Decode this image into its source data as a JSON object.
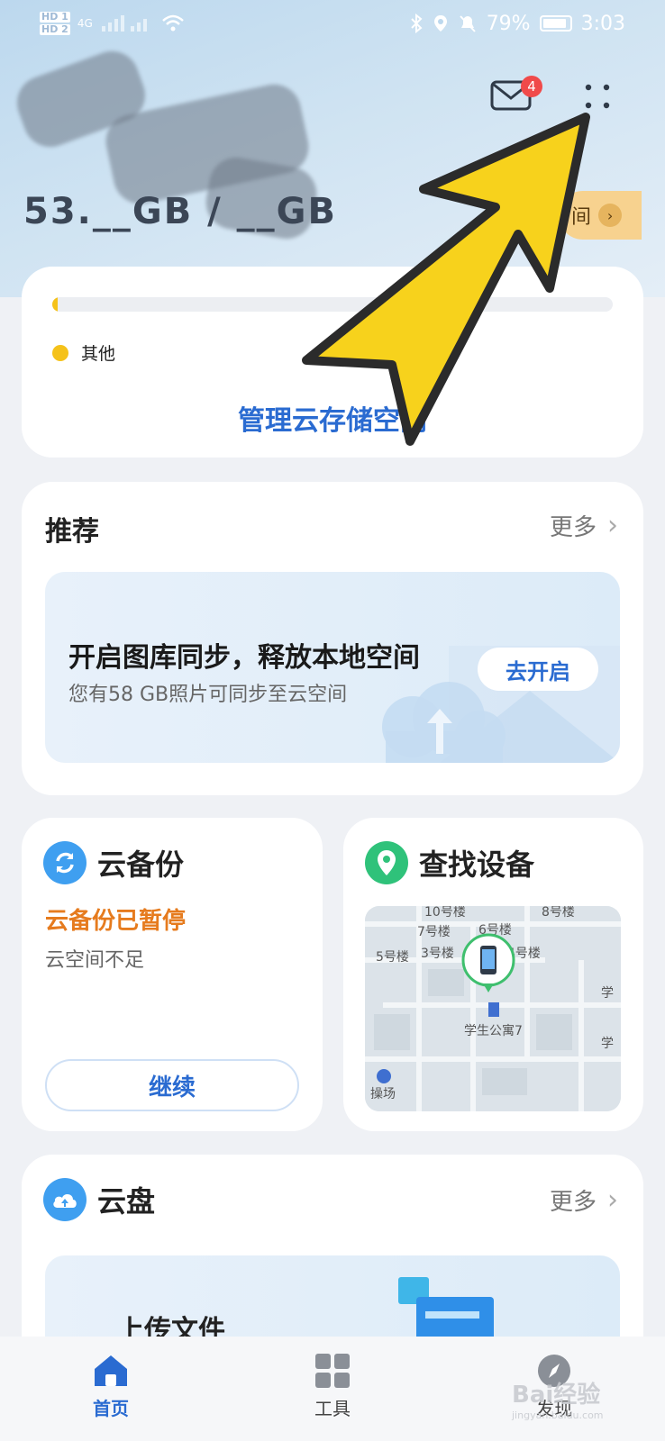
{
  "status_bar": {
    "sim1": "HD 1",
    "sim2": "HD 2",
    "network": "4G",
    "battery": "79%",
    "time": "3:03"
  },
  "header": {
    "mail_badge": "4",
    "storage_text": "53.__GB / __GB",
    "plan_pill": "间"
  },
  "storage_card": {
    "legend_other": "其他",
    "manage_link": "管理云存储空间",
    "bar_fill_percent": 1
  },
  "recommend": {
    "title": "推荐",
    "more": "更多",
    "promo_title": "开启图库同步，释放本地空间",
    "promo_sub": "您有58 GB照片可同步至云空间",
    "promo_button": "去开启"
  },
  "backup": {
    "title": "云备份",
    "status": "云备份已暂停",
    "reason": "云空间不足",
    "button": "继续"
  },
  "find_device": {
    "title": "查找设备",
    "map_labels": [
      "10号楼",
      "8号楼",
      "7号楼",
      "6号楼",
      "5号楼",
      "3号楼",
      "4号楼",
      "学生公寓7",
      "操场",
      "学",
      "学"
    ]
  },
  "cloud_disk": {
    "title": "云盘",
    "more": "更多",
    "upload": "上传文件"
  },
  "bottom_nav": {
    "home": "首页",
    "tools": "工具",
    "discover": "发现"
  },
  "watermark": "Bai经验",
  "watermark_sub": "jingyan.baidu.com",
  "colors": {
    "accent": "#2a6bd1",
    "warning": "#e67b1e",
    "arrow": "#f7d21c",
    "badge": "#f04a4a"
  }
}
